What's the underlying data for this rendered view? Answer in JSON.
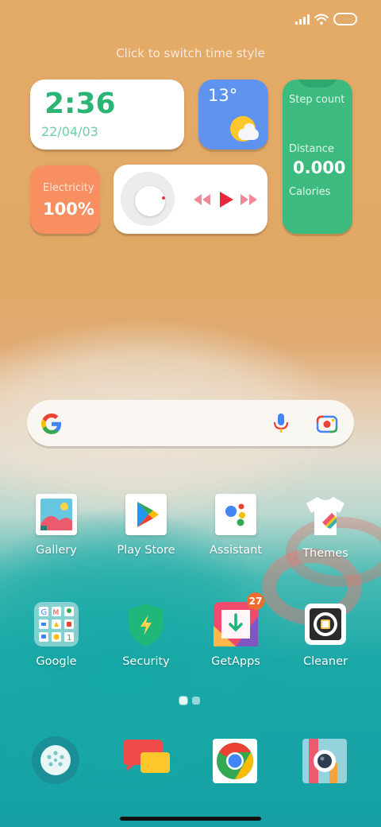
{
  "status": {
    "icons": [
      "signal-icon",
      "wifi-icon",
      "battery-icon"
    ]
  },
  "hint": "Click to switch time style",
  "widgets": {
    "clock": {
      "time": "2:36",
      "date": "22/04/03"
    },
    "weather": {
      "temp": "13°",
      "icon": "partly-cloudy-icon"
    },
    "steps": {
      "title": "Step count",
      "distance_label": "Distance",
      "distance_value": "0.000",
      "calories_label": "Calories"
    },
    "electricity": {
      "label": "Electricity",
      "value": "100%"
    },
    "music": {
      "controls": [
        "previous-icon",
        "play-icon",
        "next-icon"
      ]
    }
  },
  "search": {
    "icons": [
      "google-g-icon",
      "microphone-icon",
      "lens-camera-icon"
    ]
  },
  "apps_row1": [
    {
      "label": "Gallery"
    },
    {
      "label": "Play Store"
    },
    {
      "label": "Assistant"
    },
    {
      "label": "Themes"
    }
  ],
  "apps_row2": [
    {
      "label": "Google"
    },
    {
      "label": "Security"
    },
    {
      "label": "GetApps",
      "badge": "27"
    },
    {
      "label": "Cleaner"
    }
  ],
  "page_indicator": {
    "pages": 2,
    "current": 1
  },
  "dock": [
    "phone-icon",
    "messages-icon",
    "chrome-icon",
    "camera-icon"
  ],
  "colors": {
    "clock_green": "#2ab575",
    "weather_blue": "#5e94f0",
    "steps_green": "#3dbb7f",
    "electricity_orange": "#f78f61",
    "badge_orange": "#f26b2e"
  }
}
